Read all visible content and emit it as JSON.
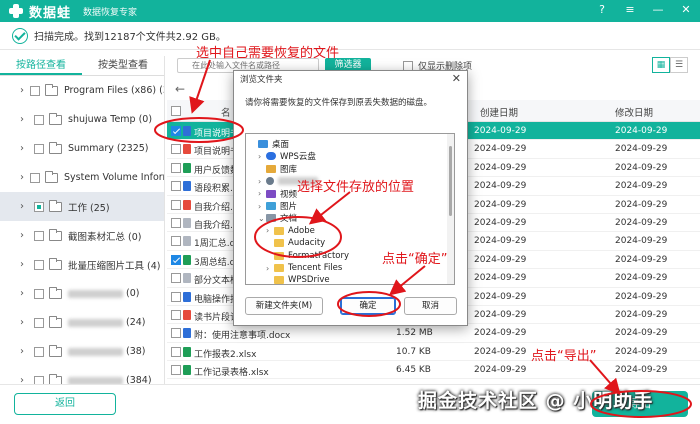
{
  "app": {
    "brand": "数据蛙",
    "subtitle": "数据恢复专家",
    "window_controls": [
      "?",
      "≡",
      "—",
      "✕"
    ]
  },
  "status": {
    "text": "扫描完成。找到12187个文件共2.92 GB。"
  },
  "left_tabs": [
    "按路径查看",
    "按类型查看"
  ],
  "tree": [
    {
      "label": "Program Files (x86) (3010",
      "state": "none",
      "blurred": false
    },
    {
      "label": "shujuwa Temp (0)",
      "state": "none",
      "blurred": false
    },
    {
      "label": "Summary (2325)",
      "state": "none",
      "blurred": false
    },
    {
      "label": "System Volume Informati",
      "state": "none",
      "blurred": false
    },
    {
      "label": "工作 (25)",
      "state": "partial",
      "blurred": false,
      "selected": true
    },
    {
      "label": "截图素材汇总 (0)",
      "state": "none",
      "blurred": false
    },
    {
      "label": "批量压缩图片工具 (4)",
      "state": "none",
      "blurred": false
    },
    {
      "label": "(0)",
      "state": "none",
      "blurred": true
    },
    {
      "label": "(24)",
      "state": "none",
      "blurred": true
    },
    {
      "label": "(38)",
      "state": "none",
      "blurred": true
    },
    {
      "label": "(384)",
      "state": "none",
      "blurred": true
    }
  ],
  "toolbar": {
    "search_placeholder": "在此处输入文件名或路径",
    "filter_label": "筛选器",
    "only_deleted_label": "仅显示删除项",
    "view_icons": [
      "grid-view-icon",
      "list-view-icon"
    ]
  },
  "table": {
    "headers": {
      "name": "名",
      "created": "创建日期",
      "modified": "修改日期"
    },
    "rows": [
      {
        "name": "项目说明书",
        "size": "",
        "created": "2024-09-29",
        "modified": "2024-09-29",
        "type": "word",
        "checked": true,
        "selected": true
      },
      {
        "name": "项目说明书",
        "size": "",
        "created": "2024-09-29",
        "modified": "2024-09-29",
        "type": "pdf",
        "checked": false
      },
      {
        "name": "用户反馈数",
        "size": "",
        "created": "2024-09-29",
        "modified": "2024-09-29",
        "type": "excel",
        "checked": false
      },
      {
        "name": "语段积累.do",
        "size": "",
        "created": "2024-09-29",
        "modified": "2024-09-29",
        "type": "word",
        "checked": false
      },
      {
        "name": "自我介绍.p",
        "size": "",
        "created": "2024-09-29",
        "modified": "2024-09-29",
        "type": "pdf",
        "checked": false
      },
      {
        "name": "自我介绍.t",
        "size": "",
        "created": "2024-09-29",
        "modified": "2024-09-29",
        "type": "text",
        "checked": false
      },
      {
        "name": "1周汇总.do",
        "size": "",
        "created": "2024-09-29",
        "modified": "2024-09-29",
        "type": "text",
        "checked": false
      },
      {
        "name": "3周总结.do",
        "size": "",
        "created": "2024-09-29",
        "modified": "2024-09-29",
        "type": "excel",
        "checked": true
      },
      {
        "name": "部分文本模",
        "size": "",
        "created": "2024-09-29",
        "modified": "2024-09-29",
        "type": "text",
        "checked": false
      },
      {
        "name": "电脑操作技",
        "size": "",
        "created": "2024-09-29",
        "modified": "2024-09-29",
        "type": "word",
        "checked": false
      },
      {
        "name": "读书片段记",
        "size": "",
        "created": "2024-09-29",
        "modified": "2024-09-29",
        "type": "pdf",
        "checked": false
      },
      {
        "name": "附：使用注意事项.docx",
        "size": "1.52 MB",
        "created": "2024-09-29",
        "modified": "2024-09-29",
        "type": "word",
        "checked": false
      },
      {
        "name": "工作报表2.xlsx",
        "size": "10.7 KB",
        "created": "2024-09-29",
        "modified": "2024-09-29",
        "type": "excel",
        "checked": false
      },
      {
        "name": "工作记录表格.xlsx",
        "size": "6.45 KB",
        "created": "2024-09-29",
        "modified": "2024-09-29",
        "type": "excel",
        "checked": false
      }
    ]
  },
  "dialog": {
    "title": "浏览文件夹",
    "prompt": "请你将需要恢复的文件保存到原丢失数据的磁盘。",
    "tree": [
      {
        "label": "桌面",
        "icon": "desktop",
        "chev": "",
        "indent": 0
      },
      {
        "label": "WPS云盘",
        "icon": "cloud",
        "chev": "›",
        "indent": 1
      },
      {
        "label": "图库",
        "icon": "lib",
        "chev": "",
        "indent": 1
      },
      {
        "label": "",
        "icon": "user",
        "chev": "›",
        "indent": 1,
        "blurred": true
      },
      {
        "label": "视频",
        "icon": "video",
        "chev": "›",
        "indent": 1
      },
      {
        "label": "图片",
        "icon": "pic",
        "chev": "›",
        "indent": 1
      },
      {
        "label": "文档",
        "icon": "docs",
        "chev": "⌄",
        "indent": 1
      },
      {
        "label": "Adobe",
        "icon": "yfolder",
        "chev": "›",
        "indent": 2
      },
      {
        "label": "Audacity",
        "icon": "yfolder",
        "chev": "",
        "indent": 2
      },
      {
        "label": "FormatFactory",
        "icon": "yfolder",
        "chev": "",
        "indent": 2
      },
      {
        "label": "Tencent Files",
        "icon": "yfolder",
        "chev": "›",
        "indent": 2
      },
      {
        "label": "WPSDrive",
        "icon": "yfolder",
        "chev": "",
        "indent": 2
      }
    ],
    "new_folder_label": "新建文件夹(M)",
    "ok_label": "确定",
    "cancel_label": "取消"
  },
  "bottom": {
    "back_label": "返回",
    "export_label": "导出"
  },
  "annotations": {
    "select_files": "选中自己需要恢复的文件",
    "choose_location": "选择文件存放的位置",
    "click_ok": "点击“确定”",
    "click_export": "点击“导出”"
  },
  "watermark": "掘金技术社区 @ 小明助手",
  "colors": {
    "accent": "#12b39c",
    "annotation": "#e0161b"
  }
}
